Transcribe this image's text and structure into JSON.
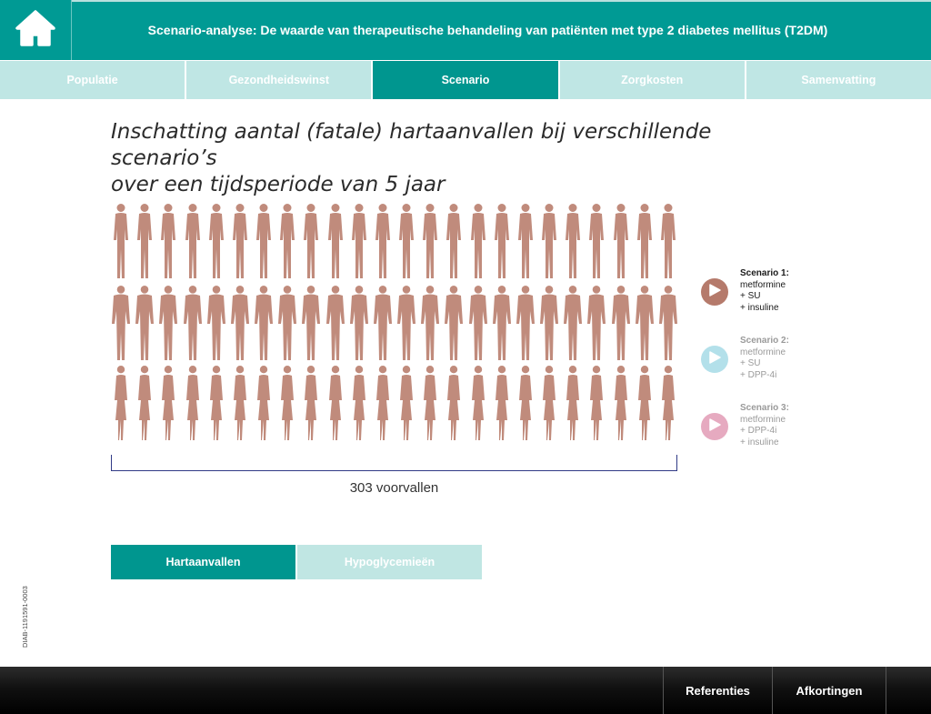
{
  "header": {
    "title": "Scenario-analyse: De waarde van therapeutische behandeling van patiënten met type 2 diabetes mellitus (T2DM)",
    "home_icon": "home-icon",
    "color": "#009a94"
  },
  "tabs": [
    {
      "label": "Populatie",
      "active": false
    },
    {
      "label": "Gezondheidswinst",
      "active": false
    },
    {
      "label": "Scenario",
      "active": true
    },
    {
      "label": "Zorgkosten",
      "active": false
    },
    {
      "label": "Samenvatting",
      "active": false
    }
  ],
  "main": {
    "heading_line1": "Inschatting aantal (fatale) hartaanvallen bij verschillende scenario’s",
    "heading_line2": "over een tijdsperiode van 5 jaar",
    "people_rows": 3,
    "people_per_row": 24,
    "people_color": "#c08b7c",
    "count_label": "303 voorvallen"
  },
  "scenarios": [
    {
      "title": "Scenario 1:",
      "lines": [
        "metformine",
        "+ SU",
        "+ insuline"
      ],
      "color": "#b57a6b",
      "active": true
    },
    {
      "title": "Scenario 2:",
      "lines": [
        "metformine",
        "+ SU",
        "+ DPP-4i"
      ],
      "color": "#b3e0ea",
      "active": false
    },
    {
      "title": "Scenario 3:",
      "lines": [
        "metformine",
        "+ DPP-4i",
        "+ insuline"
      ],
      "color": "#e6aac0",
      "active": false
    }
  ],
  "toggles": {
    "hartaanvallen": "Hartaanvallen",
    "hypoglycemieen": "Hypoglycemieën"
  },
  "side_code": "DIAB-1191591-0003",
  "footer": {
    "referenties": "Referenties",
    "afkortingen": "Afkortingen"
  }
}
